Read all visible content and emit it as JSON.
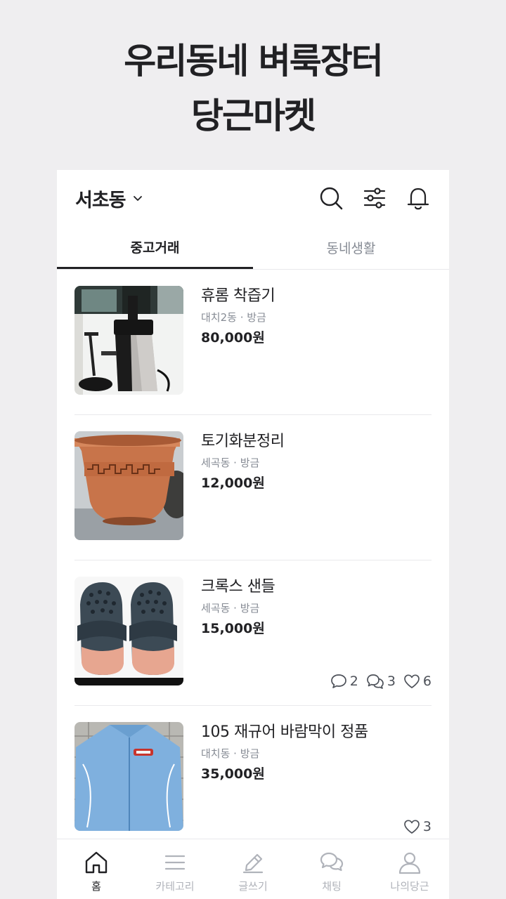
{
  "promo": {
    "line1": "우리동네 벼룩장터",
    "line2": "당근마켓"
  },
  "header": {
    "location": "서초동",
    "icons": [
      "search-icon",
      "filter-icon",
      "bell-icon"
    ]
  },
  "tabs": [
    {
      "label": "중고거래",
      "active": true
    },
    {
      "label": "동네생활",
      "active": false
    }
  ],
  "items": [
    {
      "title": "휴롬 착즙기",
      "meta": "대치2동 · 방금",
      "price": "80,000원",
      "image": "juicer"
    },
    {
      "title": "토기화분정리",
      "meta": "세곡동 · 방금",
      "price": "12,000원",
      "image": "flowerpot"
    },
    {
      "title": "크록스 샌들",
      "meta": "세곡동 · 방금",
      "price": "15,000원",
      "image": "crocs",
      "comments": "2",
      "chats": "3",
      "likes": "6"
    },
    {
      "title": "105 재규어 바람막이 정품",
      "meta": "대치동 · 방금",
      "price": "35,000원",
      "image": "jacket",
      "likes": "3"
    }
  ],
  "nav": [
    {
      "label": "홈",
      "icon": "home-icon",
      "active": true
    },
    {
      "label": "카테고리",
      "icon": "menu-icon",
      "active": false
    },
    {
      "label": "글쓰기",
      "icon": "pencil-icon",
      "active": false
    },
    {
      "label": "채팅",
      "icon": "chat-icon",
      "active": false
    },
    {
      "label": "나의당근",
      "icon": "user-icon",
      "active": false
    }
  ]
}
